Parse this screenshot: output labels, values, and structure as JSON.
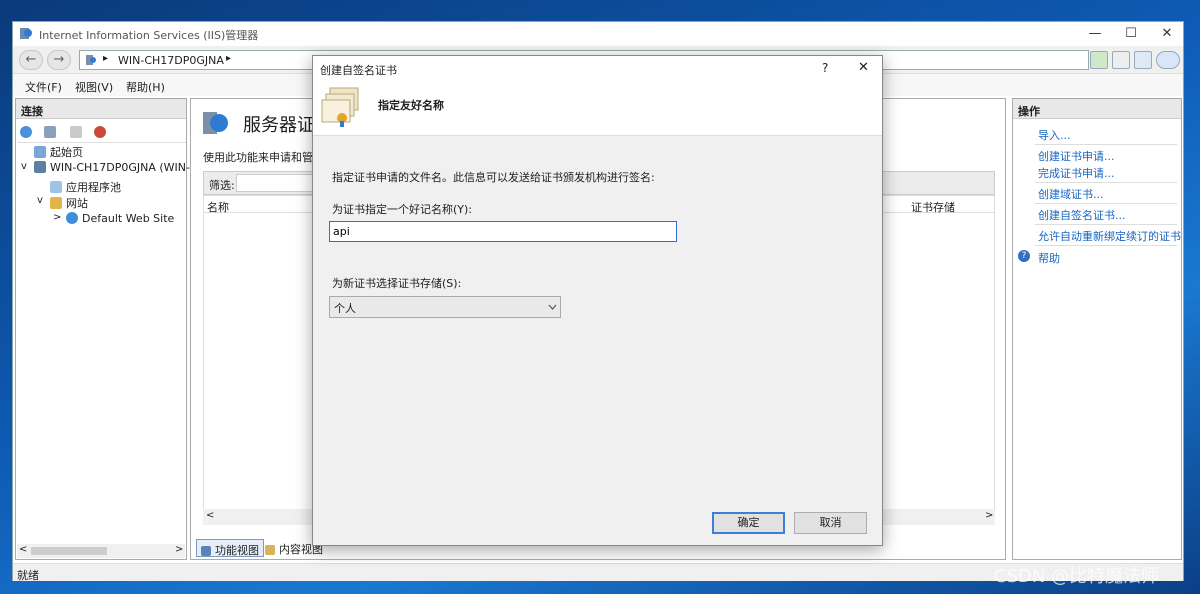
{
  "window": {
    "title": "Internet Information Services (IIS)管理器",
    "controls": {
      "minimize": "—",
      "maximize": "☐",
      "close": "✕"
    }
  },
  "address": {
    "back": "←",
    "forward": "→",
    "sep1": "▸",
    "crumb": "WIN-CH17DP0GJNA",
    "sep2": "▸"
  },
  "menu": {
    "file": "文件(F)",
    "view": "视图(V)",
    "help": "帮助(H)"
  },
  "left_pane": {
    "header": "连接",
    "tree": {
      "start_page": "起始页",
      "server": "WIN-CH17DP0GJNA (WIN-",
      "app_pools": "应用程序池",
      "sites": "网站",
      "default_site": "Default Web Site"
    },
    "expand_open": "v",
    "expand_closed": ">",
    "scroll_left": "<",
    "scroll_right": ">"
  },
  "center_pane": {
    "heading": "服务器证书",
    "description": "使用此功能来申请和管理",
    "filter_label": "筛选:",
    "col_name": "名称",
    "col_store": "证书存储",
    "scroll_left": "<",
    "scroll_right": ">",
    "tab_features": "功能视图",
    "tab_content": "内容视图"
  },
  "right_pane": {
    "header": "操作",
    "actions": [
      "导入...",
      "创建证书申请...",
      "完成证书申请...",
      "创建域证书...",
      "创建自签名证书...",
      "允许自动重新绑定续订的证书",
      "帮助"
    ]
  },
  "status": {
    "text": "就绪"
  },
  "dialog": {
    "title": "创建自签名证书",
    "help": "?",
    "close": "✕",
    "header": "指定友好名称",
    "intro": "指定证书申请的文件名。此信息可以发送给证书颁发机构进行签名:",
    "name_label": "为证书指定一个好记名称(Y):",
    "name_value": "api",
    "store_label": "为新证书选择证书存储(S):",
    "store_value": "个人",
    "ok": "确定",
    "cancel": "取消"
  },
  "watermark": "CSDN @比特魔法师",
  "colors": {
    "accent": "#2e6fd6",
    "link": "#1565c0",
    "desktop": "#0e5bb5"
  }
}
